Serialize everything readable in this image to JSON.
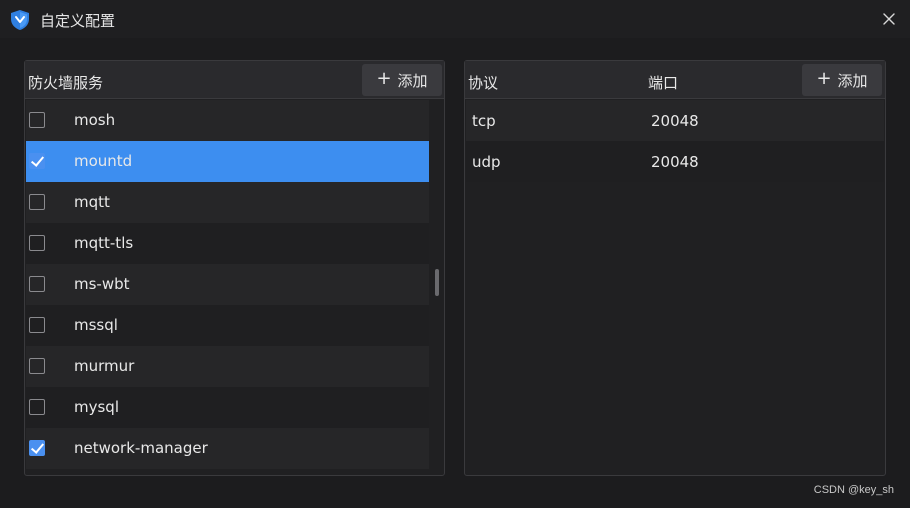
{
  "window": {
    "title": "自定义配置"
  },
  "left_panel": {
    "header": "防火墙服务",
    "add_label": "添加",
    "services": [
      {
        "name": "mosh",
        "checked": false,
        "selected": false
      },
      {
        "name": "mountd",
        "checked": true,
        "selected": true
      },
      {
        "name": "mqtt",
        "checked": false,
        "selected": false
      },
      {
        "name": "mqtt-tls",
        "checked": false,
        "selected": false
      },
      {
        "name": "ms-wbt",
        "checked": false,
        "selected": false
      },
      {
        "name": "mssql",
        "checked": false,
        "selected": false
      },
      {
        "name": "murmur",
        "checked": false,
        "selected": false
      },
      {
        "name": "mysql",
        "checked": false,
        "selected": false
      },
      {
        "name": "network-manager",
        "checked": true,
        "selected": false
      }
    ]
  },
  "right_panel": {
    "col_protocol": "协议",
    "col_port": "端口",
    "add_label": "添加",
    "rows": [
      {
        "protocol": "tcp",
        "port": "20048"
      },
      {
        "protocol": "udp",
        "port": "20048"
      }
    ]
  },
  "watermark": "CSDN @key_sh",
  "colors": {
    "accent": "#3d8ef0",
    "background": "#1c1c1e",
    "checkbox": "#4a90f0"
  }
}
